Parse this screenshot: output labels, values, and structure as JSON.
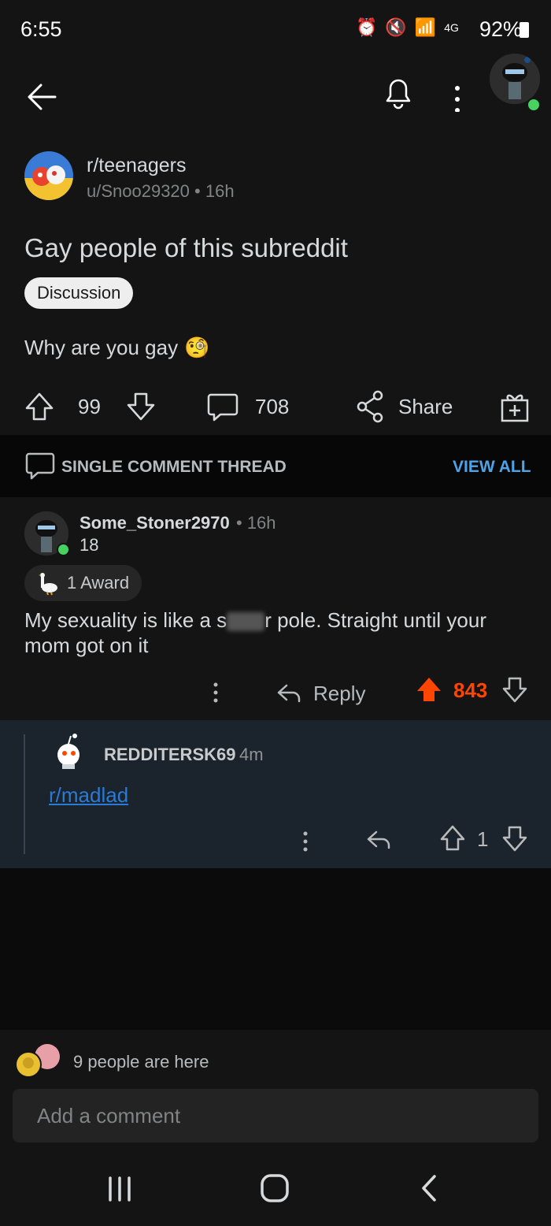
{
  "status_bar": {
    "time": "6:55",
    "network": "4G",
    "battery": "92%"
  },
  "post": {
    "subreddit": "r/teenagers",
    "author": "u/Snoo29320",
    "age": "16h",
    "title": "Gay people of this subreddit",
    "flair": "Discussion",
    "body": "Why are you gay",
    "body_emoji": "🧐",
    "upvotes": "99",
    "comments": "708",
    "share_label": "Share"
  },
  "thread_bar": {
    "label": "SINGLE COMMENT THREAD",
    "view_all": "VIEW ALL"
  },
  "comment": {
    "author": "Some_Stoner2970",
    "age": "• 16h",
    "flair": "18",
    "award": "1 Award",
    "body_start": "My sexuality is like a s",
    "body_end": "r pole. Straight until your mom got on it",
    "reply_label": "Reply",
    "score": "843",
    "score_color": "#ff4500"
  },
  "reply": {
    "author": "REDDITERSK69",
    "age": "4m",
    "link": "r/madlad",
    "score": "1"
  },
  "bottom": {
    "presence": "9 people are here",
    "input_placeholder": "Add a comment"
  }
}
